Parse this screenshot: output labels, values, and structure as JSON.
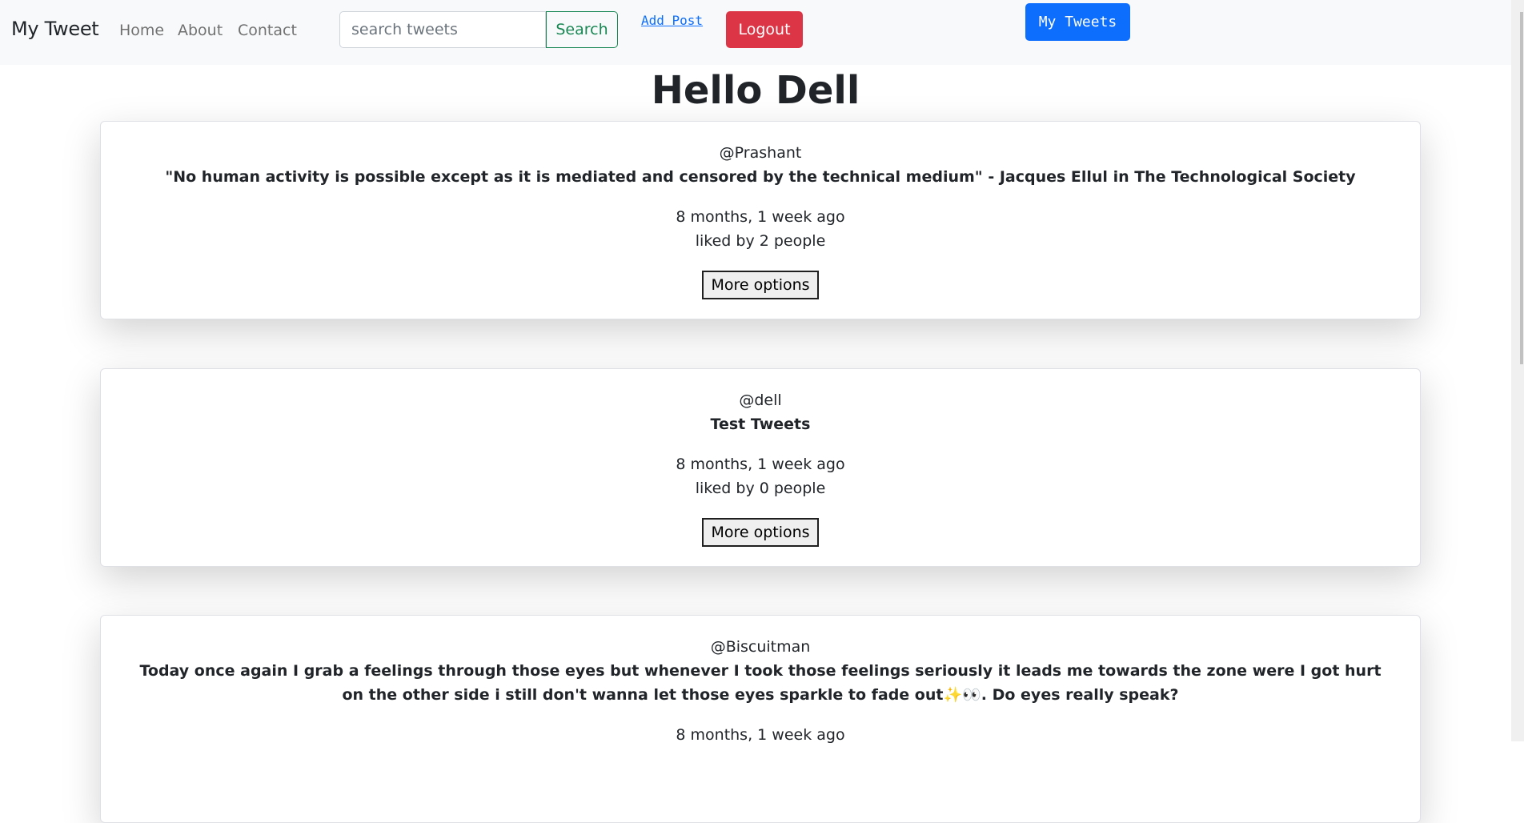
{
  "navbar": {
    "brand": "My Tweet",
    "links": [
      "Home",
      "About",
      "Contact"
    ],
    "search": {
      "placeholder": "search tweets",
      "value": "",
      "button_label": "Search"
    },
    "add_post_label": "Add Post",
    "logout_label": "Logout",
    "my_tweets_label": "My Tweets"
  },
  "colors": {
    "navbar_bg": "#f8f9fa",
    "search_green": "#198754",
    "logout_red": "#dc3545",
    "primary_blue": "#0d6efd"
  },
  "page": {
    "greeting": "Hello Dell"
  },
  "tweets": [
    {
      "author": "@Prashant",
      "text": "\"No human activity is possible except as it is mediated and censored by the technical medium\" - Jacques Ellul in The Technological Society",
      "time": "8 months, 1 week ago",
      "likes": "liked by 2 people",
      "more_label": "More options"
    },
    {
      "author": "@dell",
      "text": "Test Tweets",
      "time": "8 months, 1 week ago",
      "likes": "liked by 0 people",
      "more_label": "More options"
    },
    {
      "author": "@Biscuitman",
      "text": "Today once again I grab a feelings through those eyes but whenever I took those feelings seriously it leads me towards the zone were I got hurt on the other side i still don't wanna let those eyes sparkle to fade out✨👀. Do eyes really speak?",
      "time": "8 months, 1 week ago"
    }
  ]
}
